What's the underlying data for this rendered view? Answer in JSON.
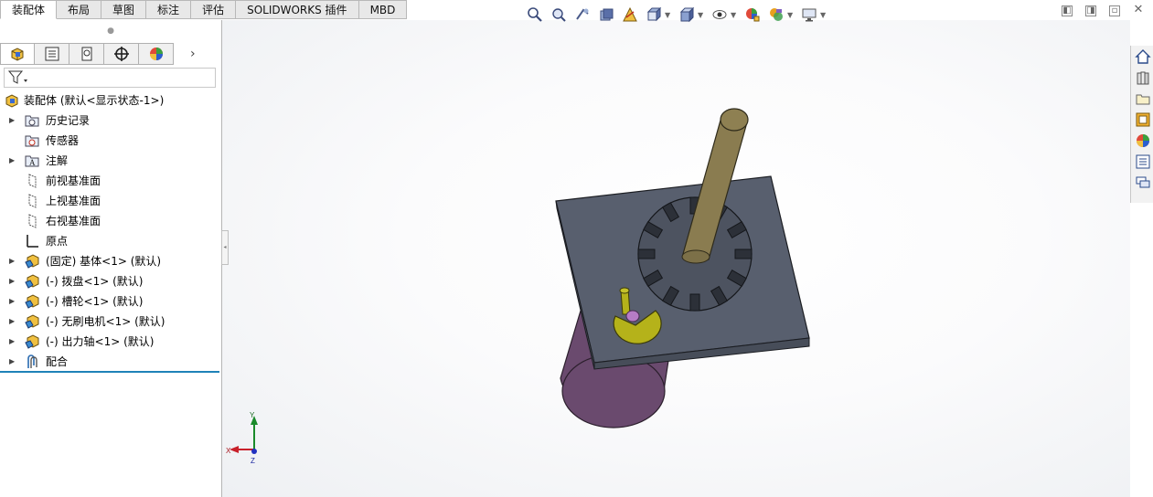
{
  "command_tabs": [
    "装配体",
    "布局",
    "草图",
    "标注",
    "评估",
    "SOLIDWORKS 插件",
    "MBD"
  ],
  "active_tab": "装配体",
  "headsup_toolbar": {
    "icons": [
      "zoom-to-fit-icon",
      "zoom-area-icon",
      "previous-view-icon",
      "section-view-icon",
      "dynamic-annotation-icon",
      "view-orientation-icon",
      "display-style-icon",
      "hide-show-items-icon",
      "edit-appearance-icon",
      "apply-scene-icon",
      "view-settings-icon"
    ]
  },
  "window_controls": [
    "tile-left-icon",
    "tile-right-icon",
    "restore-icon",
    "close-icon"
  ],
  "task_pane": {
    "icons": [
      "solidworks-resources-icon",
      "design-library-icon",
      "file-explorer-icon",
      "view-palette-icon",
      "appearances-scenes-icon",
      "custom-properties-icon",
      "forum-icon"
    ]
  },
  "manager_tabs": [
    "featuremanager-tree-icon",
    "propertymanager-icon",
    "configurationmanager-icon",
    "dimxpertmanager-icon",
    "displaymanager-icon"
  ],
  "feature_tree": {
    "root": "装配体 (默认<显示状态-1>)",
    "items": [
      {
        "label": "历史记录",
        "icon": "history-icon",
        "expandable": true
      },
      {
        "label": "传感器",
        "icon": "sensor-icon",
        "expandable": false
      },
      {
        "label": "注解",
        "icon": "annotation-icon",
        "expandable": true
      },
      {
        "label": "前视基准面",
        "icon": "plane-icon",
        "expandable": false
      },
      {
        "label": "上视基准面",
        "icon": "plane-icon",
        "expandable": false
      },
      {
        "label": "右视基准面",
        "icon": "plane-icon",
        "expandable": false
      },
      {
        "label": "原点",
        "icon": "origin-icon",
        "expandable": false
      },
      {
        "label": "(固定) 基体<1> (默认)",
        "icon": "part-icon",
        "expandable": true
      },
      {
        "label": "(-) 拨盘<1> (默认)",
        "icon": "part-icon",
        "expandable": true
      },
      {
        "label": "(-) 槽轮<1> (默认)",
        "icon": "part-icon",
        "expandable": true
      },
      {
        "label": "(-) 无刷电机<1> (默认)",
        "icon": "part-icon",
        "expandable": true
      },
      {
        "label": "(-) 出力轴<1> (默认)",
        "icon": "part-icon",
        "expandable": true
      },
      {
        "label": "配合",
        "icon": "mates-icon",
        "expandable": true
      }
    ]
  },
  "triad": {
    "x": "X",
    "y": "Y",
    "z": "Z"
  },
  "colors": {
    "base_plate": "#585f6e",
    "motor": "#6a4a6e",
    "output_shaft": "#8a7c50",
    "driver": "#b5b21a",
    "tree_separator": "#1f82b8"
  }
}
